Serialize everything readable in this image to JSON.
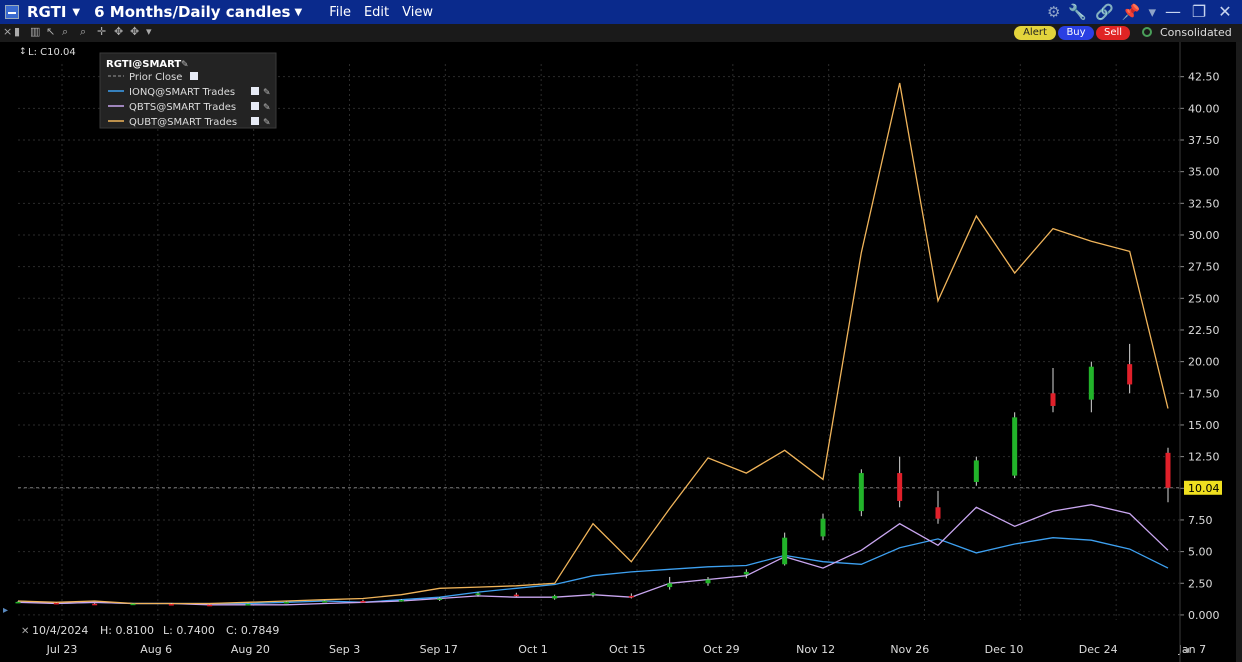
{
  "window": {
    "symbol": "RGTI",
    "period": "6 Months/Daily candles",
    "menu": [
      "File",
      "Edit",
      "View"
    ]
  },
  "toolbar": {
    "alert_label": "Alert",
    "buy_label": "Buy",
    "sell_label": "Sell",
    "feed_label": "Consolidated"
  },
  "colors": {
    "background": "#000000",
    "grid": "#2b2b2b",
    "up_candle": "#22b32a",
    "down_candle": "#e0202a",
    "ionq": "#3da0f0",
    "qbts": "#c9a6f0",
    "qubt": "#f0b45a",
    "price_tag": "#f0e020"
  },
  "last_value_label": "L: C10.04",
  "legend": {
    "title": "RGTI@SMART",
    "items": [
      {
        "label": "Prior Close",
        "style": "dashed"
      },
      {
        "label": "IONQ@SMART Trades",
        "color": "#3da0f0"
      },
      {
        "label": "QBTS@SMART Trades",
        "color": "#c9a6f0"
      },
      {
        "label": "QUBT@SMART Trades",
        "color": "#f0b45a"
      }
    ]
  },
  "status": {
    "date": "10/4/2024",
    "high": "H: 0.8100",
    "low": "L: 0.7400",
    "close": "C: 0.7849"
  },
  "chart_data": {
    "type": "line",
    "ylim": [
      -0.4,
      43.5
    ],
    "y_ticks": [
      "0.000",
      "2.50",
      "5.00",
      "7.50",
      "10.00",
      "12.50",
      "15.00",
      "17.50",
      "20.00",
      "22.50",
      "25.00",
      "27.50",
      "30.00",
      "32.50",
      "35.00",
      "37.50",
      "40.00",
      "42.50"
    ],
    "y_tick_values": [
      0,
      2.5,
      5,
      7.5,
      10,
      12.5,
      15,
      17.5,
      20,
      22.5,
      25,
      27.5,
      30,
      32.5,
      35,
      37.5,
      40,
      42.5
    ],
    "x_ticks": [
      "Jul 23",
      "Aug 6",
      "Aug 20",
      "Sep 3",
      "Sep 17",
      "Oct 1",
      "Oct 15",
      "Oct 29",
      "Nov 12",
      "Nov 26",
      "Dec 10",
      "Dec 24",
      "Jan 7"
    ],
    "x_tick_index": [
      0,
      10,
      20,
      30,
      40,
      50,
      60,
      70,
      80,
      90,
      100,
      110,
      120
    ],
    "prior_close": 10.04,
    "price_tag": "10.04",
    "series": [
      {
        "name": "IONQ@SMART Trades",
        "values": [
          1.1,
          0.9,
          1.0,
          0.9,
          0.9,
          0.9,
          0.9,
          1.0,
          1.1,
          1.0,
          1.2,
          1.4,
          1.8,
          2.1,
          2.4,
          3.1,
          3.4,
          3.6,
          3.8,
          3.9,
          4.7,
          4.2,
          4.0,
          5.3,
          6.0,
          4.9,
          5.6,
          6.1,
          5.9,
          5.2,
          3.7
        ]
      },
      {
        "name": "QBTS@SMART Trades",
        "values": [
          1.0,
          0.9,
          1.0,
          0.9,
          0.9,
          0.8,
          0.8,
          0.8,
          0.9,
          1.0,
          1.1,
          1.3,
          1.5,
          1.4,
          1.4,
          1.6,
          1.4,
          2.5,
          2.8,
          3.1,
          4.6,
          3.7,
          5.1,
          7.2,
          5.5,
          8.5,
          7.0,
          8.2,
          8.7,
          8.0,
          5.1
        ]
      },
      {
        "name": "QUBT@SMART Trades",
        "values": [
          1.1,
          1.0,
          1.1,
          0.9,
          0.9,
          0.9,
          1.0,
          1.1,
          1.2,
          1.3,
          1.6,
          2.1,
          2.2,
          2.3,
          2.5,
          7.2,
          4.2,
          8.4,
          12.4,
          11.2,
          13.0,
          10.7,
          28.6,
          42.0,
          24.8,
          31.5,
          27.0,
          30.5,
          29.5,
          28.7,
          16.3
        ]
      }
    ],
    "series_index": [
      0,
      4,
      8,
      12,
      16,
      20,
      24,
      28,
      32,
      36,
      40,
      44,
      48,
      52,
      56,
      60,
      64,
      68,
      72,
      76,
      80,
      84,
      88,
      92,
      96,
      100,
      104,
      108,
      112,
      116,
      120
    ],
    "candles_index": [
      0,
      4,
      8,
      12,
      16,
      20,
      24,
      28,
      32,
      36,
      40,
      44,
      48,
      52,
      56,
      60,
      64,
      68,
      72,
      76,
      80,
      84,
      88,
      92,
      96,
      100,
      104,
      108,
      112,
      116,
      120
    ],
    "candles": [
      {
        "o": 1.0,
        "h": 1.08,
        "l": 0.95,
        "c": 1.03
      },
      {
        "o": 0.95,
        "h": 1.0,
        "l": 0.86,
        "c": 0.9
      },
      {
        "o": 0.88,
        "h": 0.94,
        "l": 0.82,
        "c": 0.86
      },
      {
        "o": 0.84,
        "h": 0.92,
        "l": 0.8,
        "c": 0.89
      },
      {
        "o": 0.86,
        "h": 0.92,
        "l": 0.8,
        "c": 0.82
      },
      {
        "o": 0.8,
        "h": 0.86,
        "l": 0.74,
        "c": 0.78
      },
      {
        "o": 0.82,
        "h": 0.9,
        "l": 0.78,
        "c": 0.87
      },
      {
        "o": 0.95,
        "h": 1.05,
        "l": 0.9,
        "c": 1.02
      },
      {
        "o": 1.05,
        "h": 1.15,
        "l": 1.0,
        "c": 1.1
      },
      {
        "o": 1.1,
        "h": 1.2,
        "l": 1.0,
        "c": 1.06
      },
      {
        "o": 1.1,
        "h": 1.25,
        "l": 1.05,
        "c": 1.18
      },
      {
        "o": 1.2,
        "h": 1.4,
        "l": 1.1,
        "c": 1.3
      },
      {
        "o": 1.6,
        "h": 1.8,
        "l": 1.45,
        "c": 1.7
      },
      {
        "o": 1.6,
        "h": 1.75,
        "l": 1.4,
        "c": 1.5
      },
      {
        "o": 1.3,
        "h": 1.6,
        "l": 1.2,
        "c": 1.5
      },
      {
        "o": 1.6,
        "h": 1.8,
        "l": 1.4,
        "c": 1.7
      },
      {
        "o": 1.5,
        "h": 1.7,
        "l": 1.3,
        "c": 1.4
      },
      {
        "o": 2.2,
        "h": 3.0,
        "l": 2.0,
        "c": 2.5
      },
      {
        "o": 2.5,
        "h": 3.0,
        "l": 2.3,
        "c": 2.8
      },
      {
        "o": 3.2,
        "h": 3.6,
        "l": 2.9,
        "c": 3.4
      },
      {
        "o": 4.0,
        "h": 6.5,
        "l": 3.9,
        "c": 6.1
      },
      {
        "o": 6.2,
        "h": 8.0,
        "l": 5.9,
        "c": 7.6
      },
      {
        "o": 8.2,
        "h": 11.5,
        "l": 7.8,
        "c": 11.2
      },
      {
        "o": 11.2,
        "h": 12.5,
        "l": 8.5,
        "c": 9.0
      },
      {
        "o": 8.5,
        "h": 9.8,
        "l": 7.2,
        "c": 7.6
      },
      {
        "o": 10.5,
        "h": 12.5,
        "l": 10.2,
        "c": 12.2
      },
      {
        "o": 11.0,
        "h": 16.0,
        "l": 10.8,
        "c": 15.6
      },
      {
        "o": 17.5,
        "h": 19.5,
        "l": 16.0,
        "c": 16.5
      },
      {
        "o": 17.0,
        "h": 20.0,
        "l": 16.0,
        "c": 19.6
      },
      {
        "o": 19.8,
        "h": 21.4,
        "l": 17.5,
        "c": 18.2
      },
      {
        "o": 12.8,
        "h": 13.2,
        "l": 8.9,
        "c": 10.04
      }
    ]
  }
}
